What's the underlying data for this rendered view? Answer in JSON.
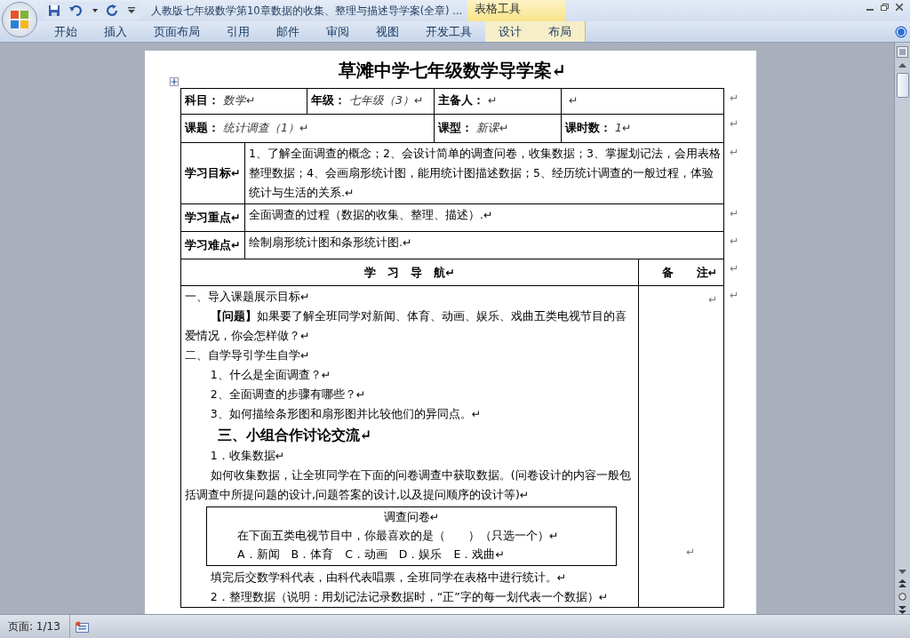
{
  "window": {
    "title": "人教版七年级数学第10章数据的收集、整理与描述导学案(全章) ...",
    "context_group": "表格工具"
  },
  "ribbon_tabs": [
    {
      "label": "开始",
      "contextual": false
    },
    {
      "label": "插入",
      "contextual": false
    },
    {
      "label": "页面布局",
      "contextual": false
    },
    {
      "label": "引用",
      "contextual": false
    },
    {
      "label": "邮件",
      "contextual": false
    },
    {
      "label": "审阅",
      "contextual": false
    },
    {
      "label": "视图",
      "contextual": false
    },
    {
      "label": "开发工具",
      "contextual": false
    },
    {
      "label": "设计",
      "contextual": true
    },
    {
      "label": "布局",
      "contextual": true
    }
  ],
  "document": {
    "title": "草滩中学七年级数学导学案↵",
    "info_rows": [
      {
        "cells": [
          {
            "label": "科目：",
            "value": "数学↵"
          },
          {
            "label": "年级：",
            "value": "七年级（3）↵"
          },
          {
            "label": "主备人：",
            "value": "↵"
          },
          {
            "value": "↵"
          }
        ],
        "end_mark": "↵"
      },
      {
        "cells": [
          {
            "label": "课题：",
            "value": "统计调查（1）↵"
          },
          {
            "label": "课型：",
            "value": "新课↵"
          },
          {
            "label": "课时数：",
            "value": "1↵"
          }
        ],
        "end_mark": "↵"
      }
    ],
    "section_rows": [
      {
        "label": "学习目标↵",
        "text": "1、了解全面调查的概念；2、会设计简单的调查问卷，收集数据；3、掌握划记法，会用表格整理数据；4、会画扇形统计图，能用统计图描述数据；5、经历统计调查的一般过程，体验统计与生活的关系.↵",
        "end_mark": "↵"
      },
      {
        "label": "学习重点↵",
        "text": "全面调查的过程（数据的收集、整理、描述）.↵",
        "end_mark": "↵"
      },
      {
        "label": "学习难点↵",
        "text": "绘制扇形统计图和条形统计图.↵",
        "end_mark": "↵"
      }
    ],
    "nav_header": {
      "main": "学　习　导　航↵",
      "notes": "备　　注↵",
      "end_mark": "↵"
    },
    "notes_cell": "↵",
    "body_end_mark": "↵",
    "body": [
      {
        "kind": "line",
        "text": "一、导入课题展示目标↵"
      },
      {
        "kind": "para",
        "text": "**【问题】**如果要了解全班同学对新闻、体育、动画、娱乐、戏曲五类电视节目的喜爱情况，你会怎样做？↵"
      },
      {
        "kind": "line",
        "text": "二、自学导引学生自学↵"
      },
      {
        "kind": "item",
        "text": "1、什么是全面调查？↵"
      },
      {
        "kind": "item",
        "text": "2、全面调查的步骤有哪些？↵"
      },
      {
        "kind": "item",
        "text": "3、如何描绘条形图和扇形图并比较他们的异同点。↵"
      },
      {
        "kind": "heading",
        "text": "三、小组合作讨论交流↵"
      },
      {
        "kind": "item",
        "text": "1．收集数据↵"
      },
      {
        "kind": "para",
        "text": "如何收集数据，让全班同学在下面的问卷调查中获取数据。(问卷设计的内容一般包括调查中所提问题的设计,问题答案的设计,以及提问顺序的设计等)↵"
      },
      {
        "kind": "box",
        "title": "调查问卷↵",
        "lines": [
          "在下面五类电视节目中，你最喜欢的是（　　）（只选一个）↵",
          "A．新闻　B．体育　C．动画　D．娱乐　E．戏曲↵"
        ],
        "end_mark": "↵"
      },
      {
        "kind": "item",
        "text": "填完后交数学科代表，由科代表唱票，全班同学在表格中进行统计。↵"
      },
      {
        "kind": "item",
        "text": "2．整理数据（说明：用划记法记录数据时，“正”字的每一划代表一个数据）↵"
      }
    ]
  },
  "status_bar": {
    "page": "页面: 1/13"
  }
}
